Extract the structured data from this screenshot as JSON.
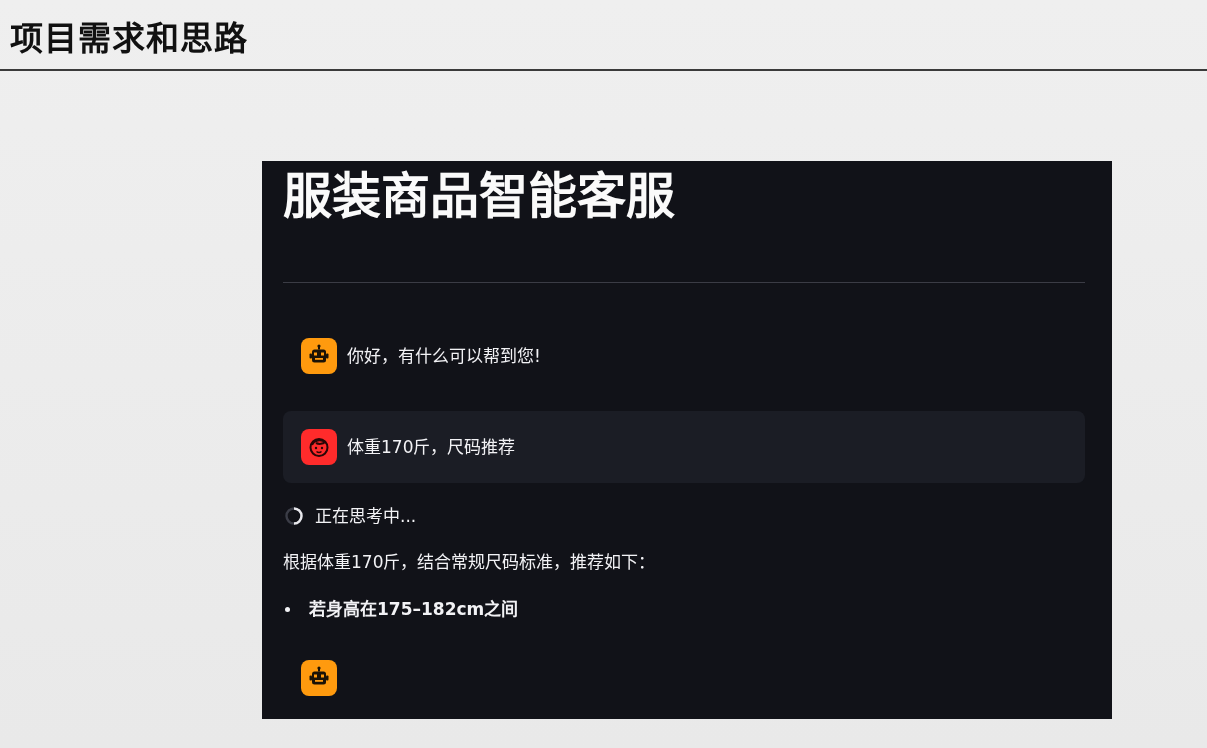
{
  "slide": {
    "title": "项目需求和思路"
  },
  "app": {
    "title": "服装商品智能客服",
    "messages": [
      {
        "kind": "assistant",
        "text": "你好，有什么可以帮到您!"
      },
      {
        "kind": "user",
        "text": "体重170斤，尺码推荐"
      }
    ],
    "status": {
      "text": "正在思考中..."
    },
    "answer": {
      "intro": "根据体重170斤，结合常规尺码标准，推荐如下：",
      "bullets": [
        "若身高在175–182cm之间"
      ]
    },
    "pending_message": {
      "kind": "assistant"
    }
  }
}
